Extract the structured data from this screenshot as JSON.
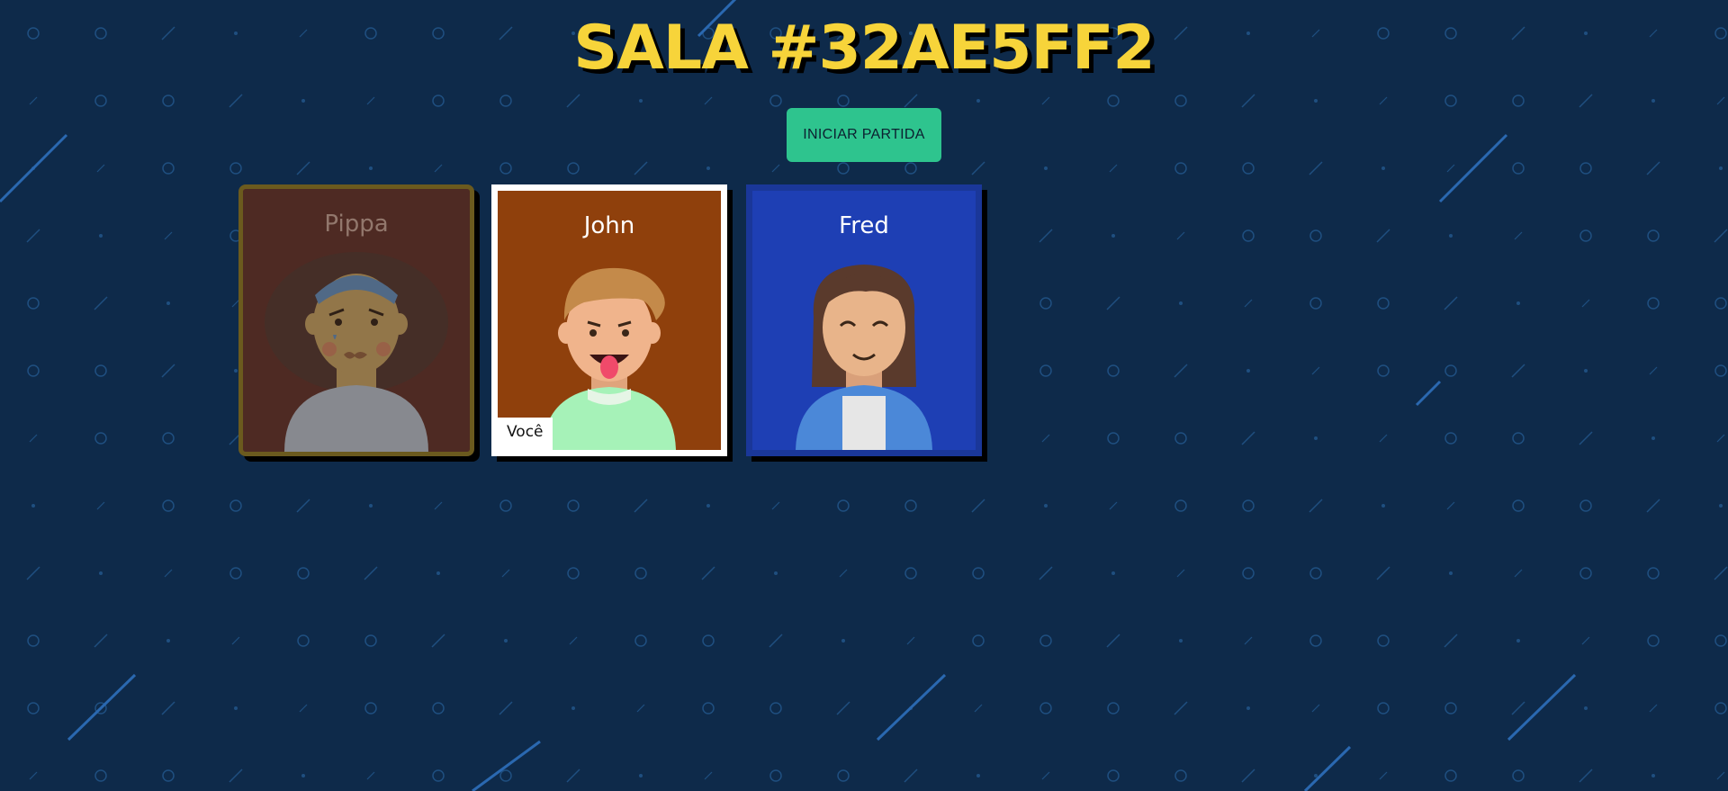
{
  "room": {
    "title": "SALA #32AE5FF2",
    "start_button_label": "INICIAR PARTIDA"
  },
  "players": [
    {
      "name": "Pippa",
      "avatar_icon": "sad-girl-avatar-icon",
      "card_color": "#562c2a",
      "status": "ready"
    },
    {
      "name": "John",
      "avatar_icon": "tongue-out-boy-avatar-icon",
      "card_color": "#8f400c",
      "is_you": true,
      "you_label": "Você"
    },
    {
      "name": "Fred",
      "avatar_icon": "smiling-man-avatar-icon",
      "card_color": "#1e3fb4"
    }
  ],
  "colors": {
    "background": "#0e2a4a",
    "title": "#f7d43a",
    "accent": "#2ec48e"
  }
}
